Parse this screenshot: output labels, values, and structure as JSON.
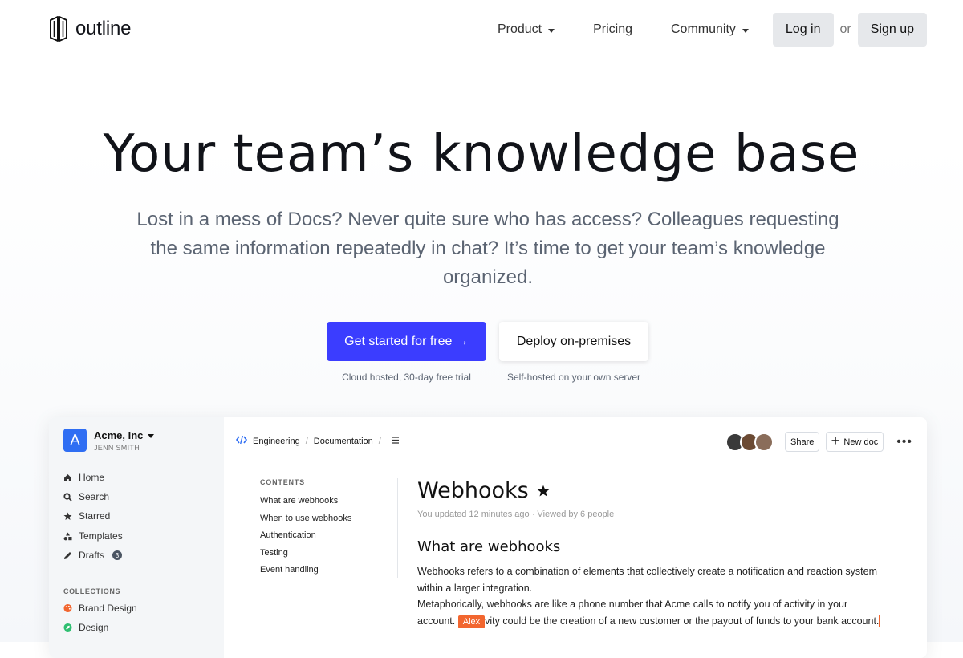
{
  "brand": {
    "name": "outline"
  },
  "nav": {
    "product": "Product",
    "pricing": "Pricing",
    "community": "Community",
    "login": "Log in",
    "or": "or",
    "signup": "Sign up"
  },
  "hero": {
    "title": "Your team’s knowledge base",
    "subtitle": "Lost in a mess of Docs? Never quite sure who has access? Colleagues requesting the same information repeatedly in chat? It’s time to get your team’s knowledge organized.",
    "cta_primary": "Get started for free →",
    "cta_secondary": "Deploy on-premises",
    "note_primary": "Cloud hosted, 30-day free trial",
    "note_secondary": "Self-hosted on your own server"
  },
  "app": {
    "team": {
      "avatar": "A",
      "name": "Acme, Inc",
      "user": "JENN SMITH"
    },
    "sidebar": {
      "home": "Home",
      "search": "Search",
      "starred": "Starred",
      "templates": "Templates",
      "drafts": "Drafts",
      "drafts_count": "3",
      "collections_heading": "COLLECTIONS",
      "brand_design": "Brand Design",
      "design": "Design"
    },
    "breadcrumb": {
      "collection": "Engineering",
      "doc": "Documentation"
    },
    "toolbar": {
      "share": "Share",
      "new_doc": "New doc"
    },
    "toc": {
      "heading": "CONTENTS",
      "items": [
        "What are webhooks",
        "When to use webhooks",
        "Authentication",
        "Testing",
        "Event handling"
      ]
    },
    "doc": {
      "title": "Webhooks",
      "meta": "You updated 12 minutes ago · Viewed by 6 people",
      "h2": "What are webhooks",
      "p1": "Webhooks refers to a combination of elements that collectively create a notification and reaction system within a larger integration.",
      "p2_a": "Metaphorically, webhooks are like a phone number that Acme calls to notify you of activity in your account. ",
      "p2_b": "vity could be the creation of a new customer or the payout of funds to your bank account.",
      "cursor_user": "Alex"
    }
  },
  "colors": {
    "primary": "#3b3dff",
    "team_avatar": "#2f6ef3",
    "cursor": "#f2662f",
    "brand_design_icon": "#f2662f",
    "design_icon": "#2fbf71"
  }
}
